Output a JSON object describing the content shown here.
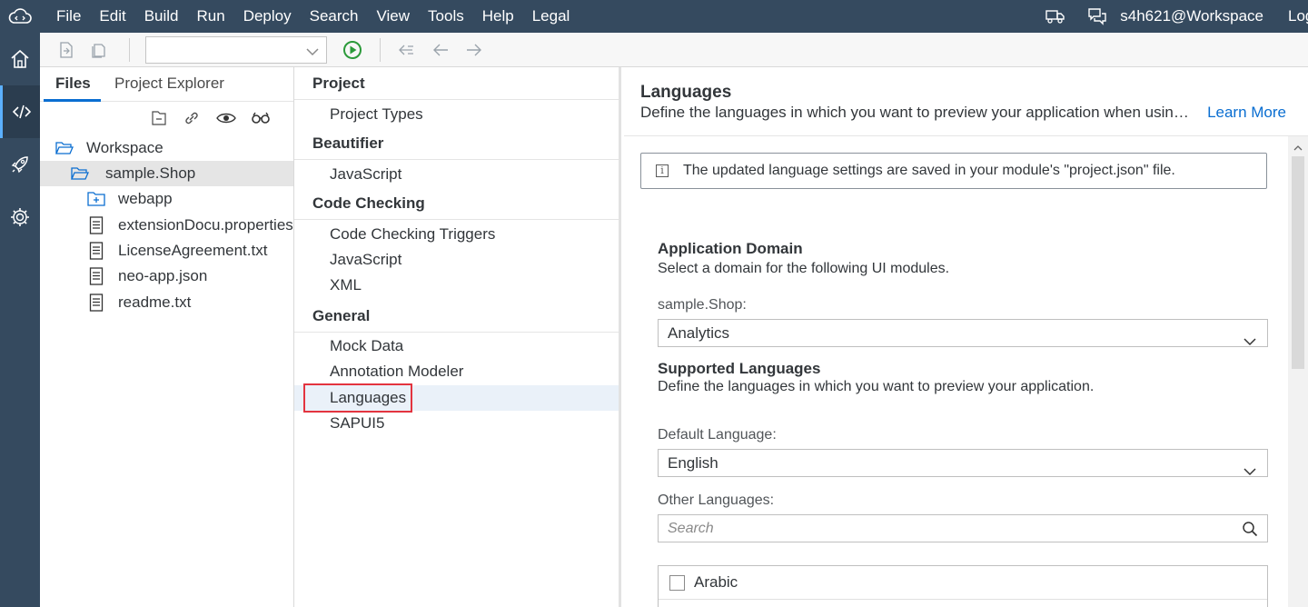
{
  "menubar": {
    "items": [
      "File",
      "Edit",
      "Build",
      "Run",
      "Deploy",
      "Search",
      "View",
      "Tools",
      "Help",
      "Legal"
    ],
    "user": "s4h621@Workspace",
    "logout": "Log"
  },
  "files_pane": {
    "tabs": [
      "Files",
      "Project Explorer"
    ],
    "tree": [
      {
        "label": "Workspace",
        "icon": "folder-open-icon"
      },
      {
        "label": "sample.Shop",
        "icon": "folder-open-icon"
      },
      {
        "label": "webapp",
        "icon": "folder-plus-icon"
      },
      {
        "label": "extensionDocu.properties",
        "icon": "document-icon"
      },
      {
        "label": "LicenseAgreement.txt",
        "icon": "document-icon"
      },
      {
        "label": "neo-app.json",
        "icon": "document-icon"
      },
      {
        "label": "readme.txt",
        "icon": "document-icon"
      }
    ]
  },
  "settings_pane": {
    "groups": [
      {
        "title": "Project",
        "items": [
          "Project Types"
        ]
      },
      {
        "title": "Beautifier",
        "items": [
          "JavaScript"
        ]
      },
      {
        "title": "Code Checking",
        "items": [
          "Code Checking Triggers",
          "JavaScript",
          "XML"
        ]
      },
      {
        "title": "General",
        "items": [
          "Mock Data",
          "Annotation Modeler",
          "Languages",
          "SAPUI5"
        ]
      }
    ],
    "selected": "Languages"
  },
  "detail": {
    "title": "Languages",
    "description": "Define the languages in which you want to preview your application when using th...",
    "learn_more": "Learn More",
    "info_message": "The updated language settings are saved in your module's \"project.json\" file.",
    "app_domain": {
      "title": "Application Domain",
      "description": "Select a domain for the following UI modules.",
      "module_label": "sample.Shop:",
      "value": "Analytics"
    },
    "supported": {
      "title": "Supported Languages",
      "description": "Define the languages in which you want to preview your application.",
      "default_label": "Default Language:",
      "default_value": "English",
      "other_label": "Other Languages:",
      "search_placeholder": "Search",
      "languages": [
        "Arabic"
      ]
    }
  },
  "colors": {
    "shell": "#354a5f",
    "accent": "#0a6ed1",
    "highlight": "#e3343f",
    "run_green": "#2b9a3a"
  }
}
